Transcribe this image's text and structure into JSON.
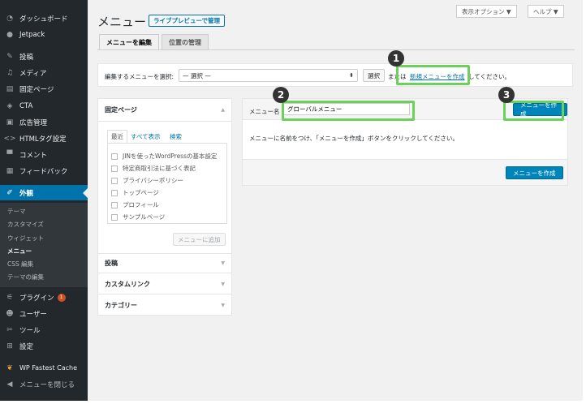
{
  "sidebar": {
    "items": [
      {
        "label": "ダッシュボード",
        "icon": "dashboard-icon"
      },
      {
        "label": "Jetpack",
        "icon": "jetpack-icon"
      },
      {
        "label": "投稿",
        "icon": "pin-icon"
      },
      {
        "label": "メディア",
        "icon": "media-icon"
      },
      {
        "label": "固定ページ",
        "icon": "page-icon"
      },
      {
        "label": "CTA",
        "icon": "cta-icon"
      },
      {
        "label": "広告管理",
        "icon": "ad-icon"
      },
      {
        "label": "HTMLタグ設定",
        "icon": "code-icon"
      },
      {
        "label": "コメント",
        "icon": "comment-icon"
      },
      {
        "label": "フィードバック",
        "icon": "feedback-icon"
      },
      {
        "label": "外観",
        "icon": "appearance-icon"
      }
    ],
    "submenu": [
      "テーマ",
      "カスタマイズ",
      "ウィジェット",
      "メニュー",
      "CSS 編集",
      "テーマの編集"
    ],
    "lower_items": [
      {
        "label": "プラグイン",
        "icon": "plugin-icon",
        "badge": "1"
      },
      {
        "label": "ユーザー",
        "icon": "user-icon"
      },
      {
        "label": "ツール",
        "icon": "tool-icon"
      },
      {
        "label": "設定",
        "icon": "settings-icon"
      },
      {
        "label": "WP Fastest Cache",
        "icon": "cheetah-icon"
      },
      {
        "label": "メニューを閉じる",
        "icon": "collapse-icon"
      }
    ]
  },
  "header": {
    "screen_options": "表示オプション ▼",
    "help": "ヘルプ ▼",
    "title": "メニュー",
    "live_preview": "ライブプレビューで管理"
  },
  "tabs": [
    "メニューを編集",
    "位置の管理"
  ],
  "select_menu": {
    "label": "編集するメニューを選択:",
    "value": "— 選択 —",
    "button": "選択",
    "or_text": "または",
    "create_link": "新規メニューを作成",
    "suffix": "してください。"
  },
  "accordion": {
    "pages_title": "固定ページ",
    "page_tabs": [
      "最近",
      "すべて表示",
      "検索"
    ],
    "pages": [
      "JINを使ったWordPressの基本設定",
      "特定商取引法に基づく表記",
      "プライバシーポリシー",
      "トップページ",
      "プロフィール",
      "サンプルページ"
    ],
    "add_button": "メニューに追加",
    "sections": [
      "投稿",
      "カスタムリンク",
      "カテゴリー"
    ]
  },
  "edit": {
    "name_label": "メニュー名",
    "name_value": "グローバルメニュー",
    "create_button": "メニューを作成",
    "instruction": "メニューに名前をつけ、「メニューを作成」ボタンをクリックしてください。"
  },
  "callouts": [
    "1",
    "2",
    "3"
  ],
  "colors": {
    "sidebar_bg": "#23282d",
    "active": "#0073aa",
    "highlight": "#6cd15a",
    "primary_button": "#0085ba"
  }
}
